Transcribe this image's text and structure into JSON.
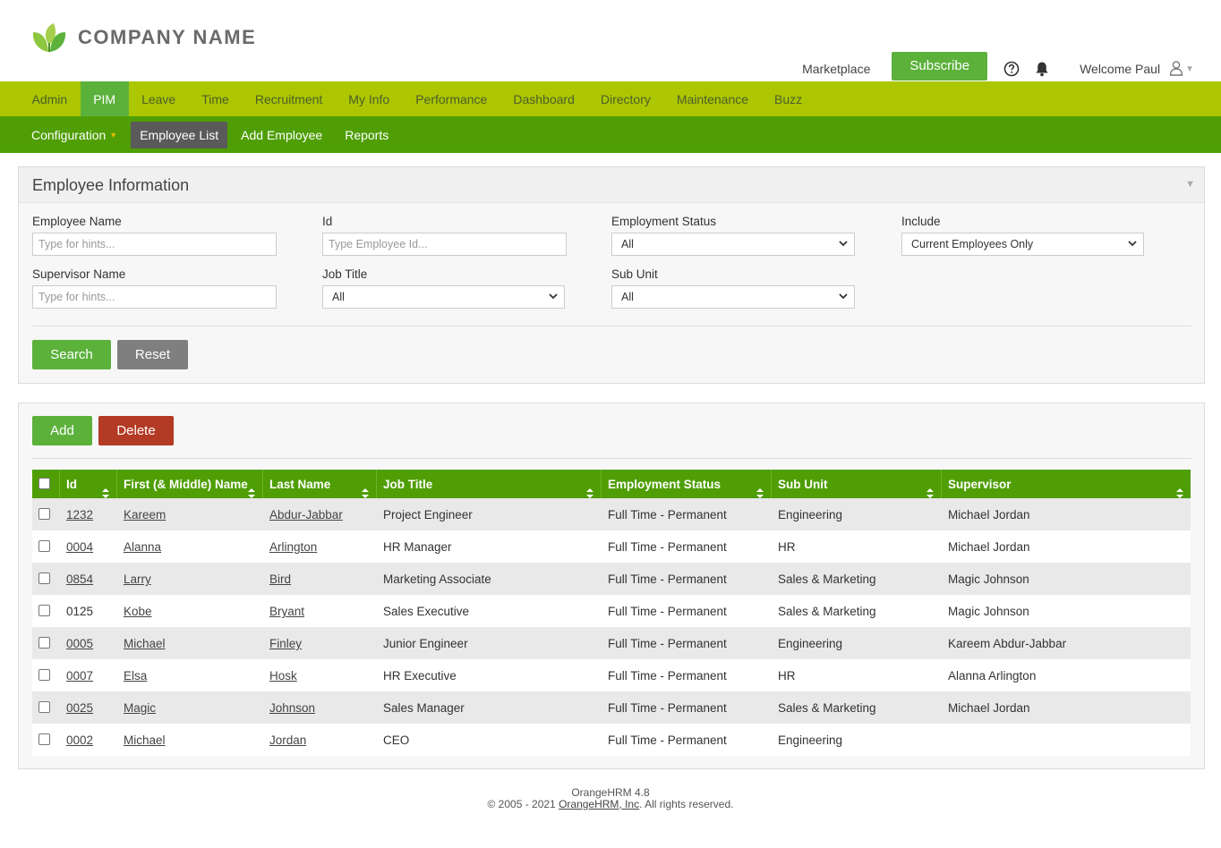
{
  "header": {
    "company": "COMPANY NAME",
    "marketplace": "Marketplace",
    "subscribe": "Subscribe",
    "welcome": "Welcome Paul"
  },
  "mainnav": [
    "Admin",
    "PIM",
    "Leave",
    "Time",
    "Recruitment",
    "My Info",
    "Performance",
    "Dashboard",
    "Directory",
    "Maintenance",
    "Buzz"
  ],
  "mainnav_active": "PIM",
  "subnav": {
    "configuration": "Configuration",
    "employee_list": "Employee List",
    "add_employee": "Add Employee",
    "reports": "Reports"
  },
  "search_panel": {
    "title": "Employee Information",
    "employee_name_label": "Employee Name",
    "employee_name_placeholder": "Type for hints...",
    "id_label": "Id",
    "id_placeholder": "Type Employee Id...",
    "employment_status_label": "Employment Status",
    "employment_status_value": "All",
    "include_label": "Include",
    "include_value": "Current Employees Only",
    "supervisor_label": "Supervisor Name",
    "supervisor_placeholder": "Type for hints...",
    "job_title_label": "Job Title",
    "job_title_value": "All",
    "sub_unit_label": "Sub Unit",
    "sub_unit_value": "All",
    "search_button": "Search",
    "reset_button": "Reset"
  },
  "list_panel": {
    "add_button": "Add",
    "delete_button": "Delete",
    "columns": [
      "Id",
      "First (& Middle) Name",
      "Last Name",
      "Job Title",
      "Employment Status",
      "Sub Unit",
      "Supervisor"
    ],
    "rows": [
      {
        "id": "1232",
        "first": "Kareem",
        "last": "Abdur-Jabbar",
        "job": "Project Engineer",
        "status": "Full Time - Permanent",
        "unit": "Engineering",
        "supervisor": "Michael Jordan",
        "id_link": true
      },
      {
        "id": "0004",
        "first": "Alanna",
        "last": "Arlington",
        "job": "HR Manager",
        "status": "Full Time - Permanent",
        "unit": "HR",
        "supervisor": "Michael Jordan",
        "id_link": true
      },
      {
        "id": "0854",
        "first": "Larry",
        "last": "Bird",
        "job": "Marketing Associate",
        "status": "Full Time - Permanent",
        "unit": "Sales & Marketing",
        "supervisor": "Magic Johnson",
        "id_link": true
      },
      {
        "id": "0125",
        "first": "Kobe",
        "last": "Bryant",
        "job": "Sales Executive",
        "status": "Full Time - Permanent",
        "unit": "Sales & Marketing",
        "supervisor": "Magic Johnson",
        "id_link": false
      },
      {
        "id": "0005",
        "first": "Michael",
        "last": "Finley",
        "job": "Junior Engineer",
        "status": "Full Time - Permanent",
        "unit": "Engineering",
        "supervisor": "Kareem Abdur-Jabbar",
        "id_link": true
      },
      {
        "id": "0007",
        "first": "Elsa",
        "last": "Hosk",
        "job": "HR Executive",
        "status": "Full Time - Permanent",
        "unit": "HR",
        "supervisor": "Alanna Arlington",
        "id_link": true
      },
      {
        "id": "0025",
        "first": "Magic",
        "last": "Johnson",
        "job": "Sales Manager",
        "status": "Full Time - Permanent",
        "unit": "Sales & Marketing",
        "supervisor": "Michael Jordan",
        "id_link": true
      },
      {
        "id": "0002",
        "first": "Michael",
        "last": "Jordan",
        "job": "CEO",
        "status": "Full Time - Permanent",
        "unit": "Engineering",
        "supervisor": "",
        "id_link": true
      }
    ]
  },
  "footer": {
    "version": "OrangeHRM 4.8",
    "copyright_prefix": "© 2005 - 2021 ",
    "copyright_link": "OrangeHRM, Inc",
    "copyright_suffix": ". All rights reserved."
  },
  "colors": {
    "brand_green": "#5cb13b",
    "nav_lime": "#acc700",
    "subnav_green": "#4f9e06",
    "delete_red": "#b33a24"
  },
  "icons": [
    "logo-leaf-icon",
    "help-icon",
    "bell-icon",
    "user-icon",
    "chevron-down-icon",
    "sort-icon",
    "checkbox"
  ]
}
